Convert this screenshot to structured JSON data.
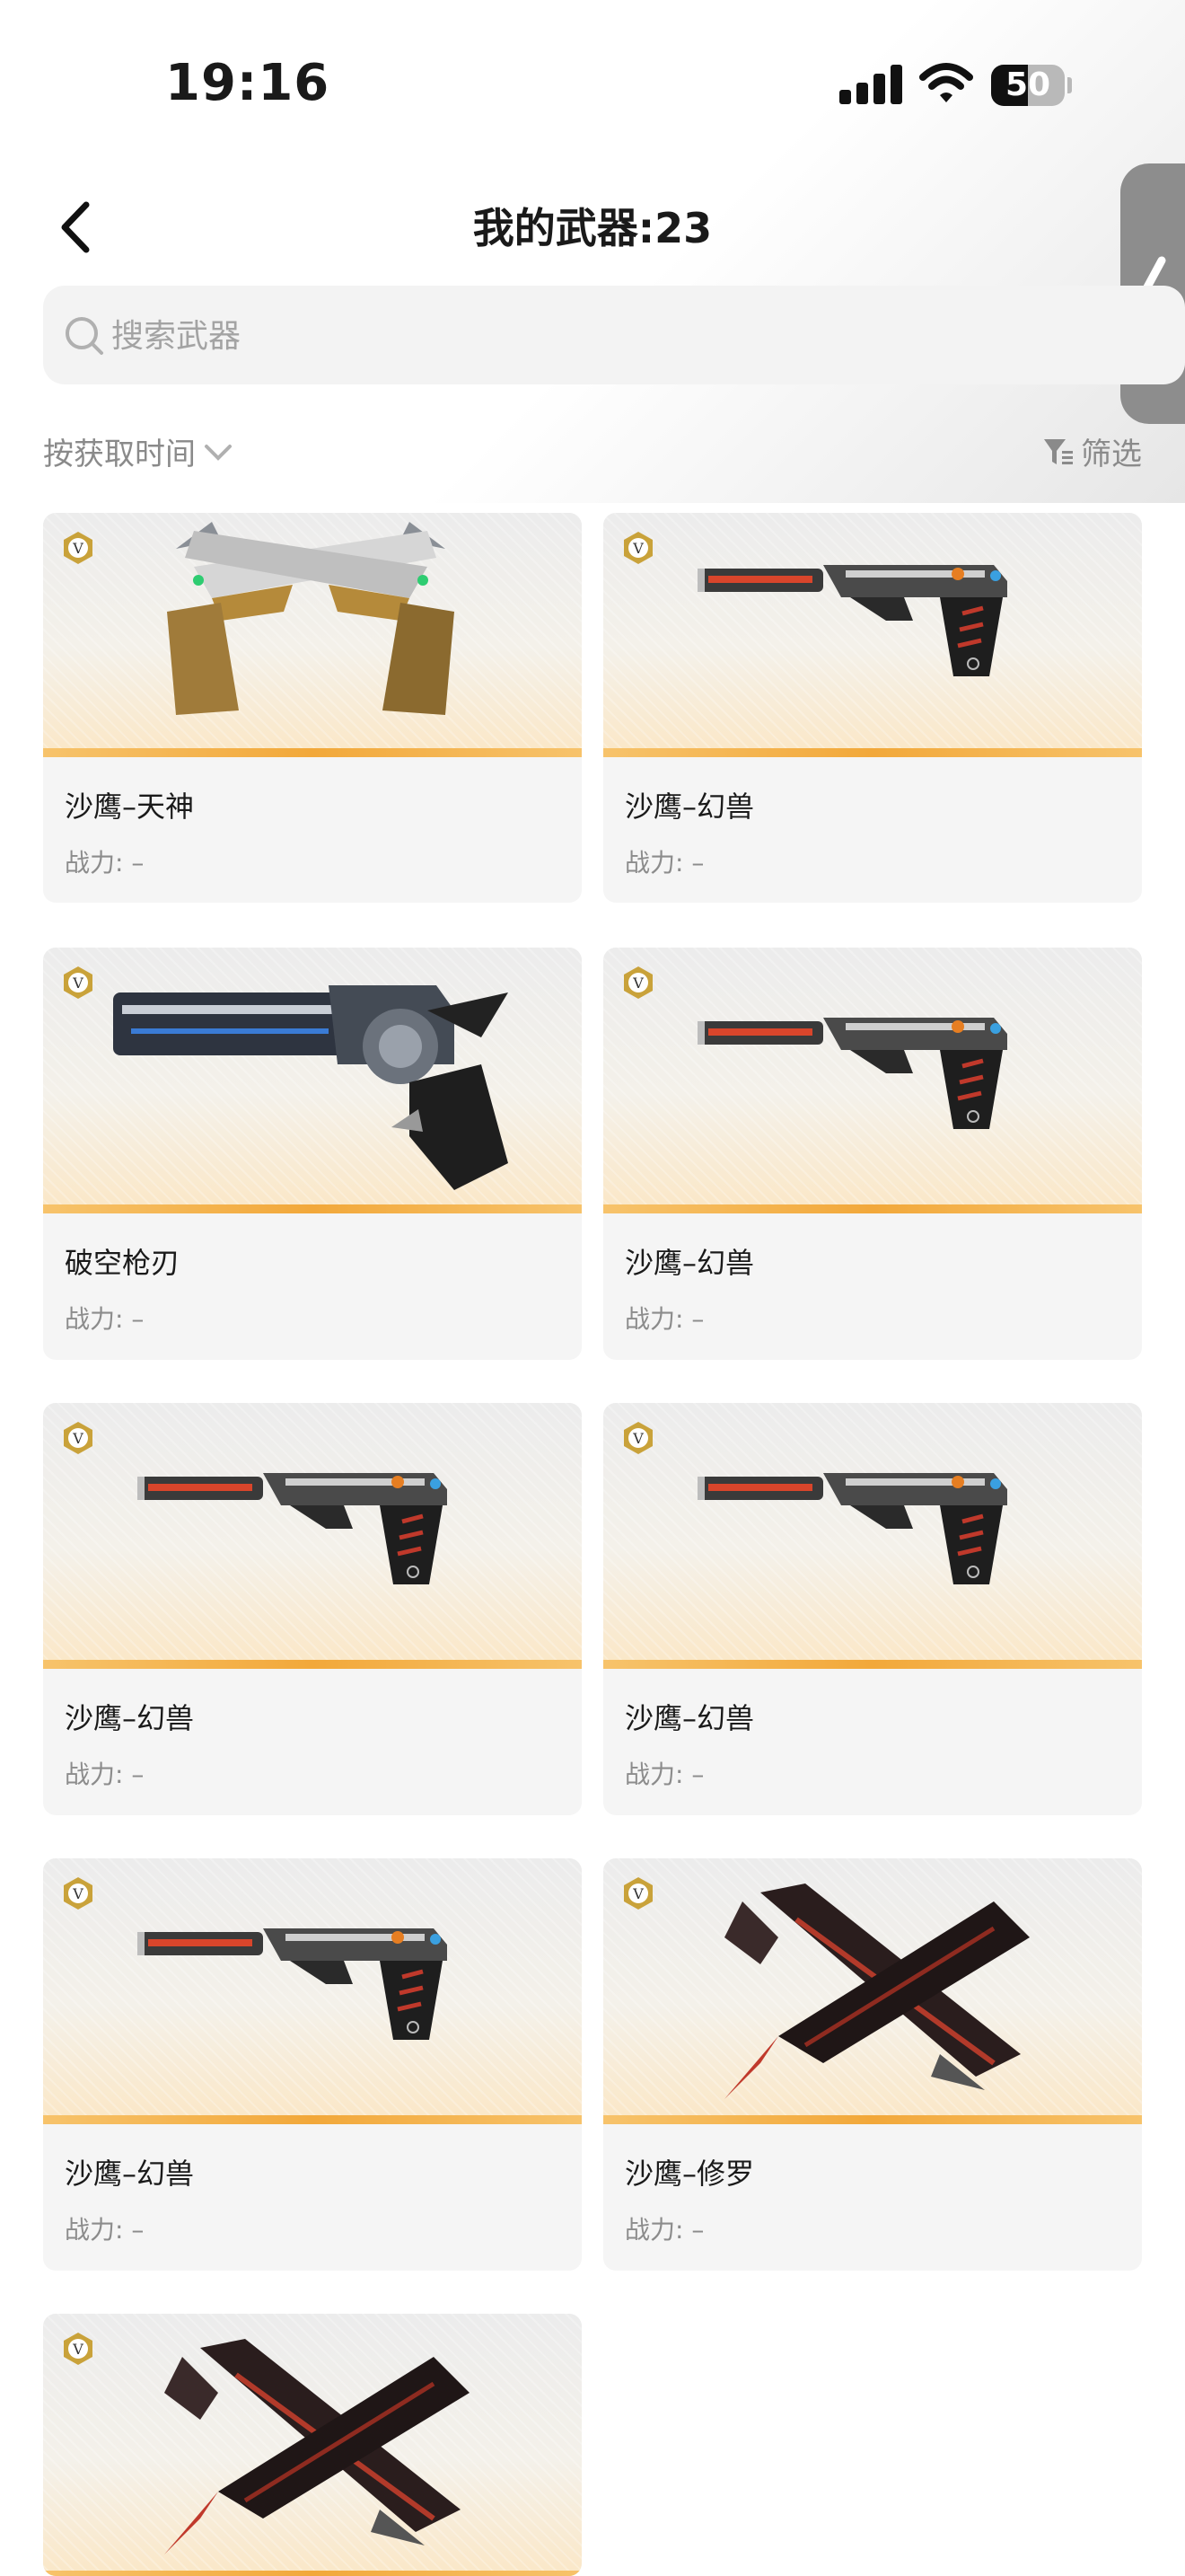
{
  "status": {
    "time": "19:16",
    "battery": "50",
    "battery_level": 0.5
  },
  "header": {
    "title": "我的武器:23"
  },
  "search": {
    "placeholder": "搜索武器"
  },
  "toolbar": {
    "sort_label": "按获取时间",
    "filter_label": "筛选"
  },
  "power_label": "战力: –",
  "weapons": [
    {
      "name": "沙鹰–天神",
      "art": "dual-gold-deagle"
    },
    {
      "name": "沙鹰–幻兽",
      "art": "silenced-deagle"
    },
    {
      "name": "破空枪刃",
      "art": "revolver-blade"
    },
    {
      "name": "沙鹰–幻兽",
      "art": "silenced-deagle"
    },
    {
      "name": "沙鹰–幻兽",
      "art": "silenced-deagle"
    },
    {
      "name": "沙鹰–幻兽",
      "art": "silenced-deagle"
    },
    {
      "name": "沙鹰–幻兽",
      "art": "silenced-deagle"
    },
    {
      "name": "沙鹰–修罗",
      "art": "crossed-dark-deagle"
    },
    {
      "name": "",
      "art": "crossed-dark-deagle"
    }
  ],
  "colors": {
    "accent_stripe": "#f2a83a",
    "badge": "#c9a23a"
  }
}
